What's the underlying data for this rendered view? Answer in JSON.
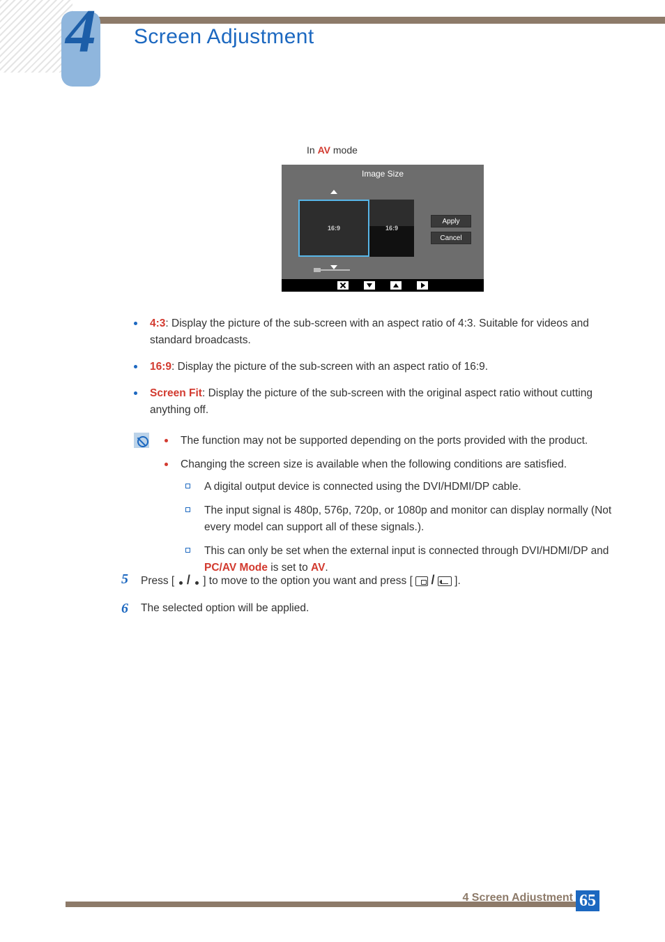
{
  "chapter": {
    "number": "4",
    "title": "Screen Adjustment"
  },
  "mode_label": {
    "prefix": "In ",
    "av": "AV",
    "suffix": " mode"
  },
  "osd": {
    "title": "Image Size",
    "left_ratio": "16:9",
    "right_ratio": "16:9",
    "apply": "Apply",
    "cancel": "Cancel"
  },
  "bullets": [
    {
      "term": "4:3",
      "text": ": Display the picture of the sub-screen with an aspect ratio of 4:3. Suitable for videos and standard broadcasts."
    },
    {
      "term": "16:9",
      "text": ": Display the picture of the sub-screen with an aspect ratio of 16:9."
    },
    {
      "term": "Screen Fit",
      "text": ": Display the picture of the sub-screen with the original aspect ratio without cutting anything off."
    }
  ],
  "notes": {
    "line1": "The function may not be supported depending on the ports provided with the product.",
    "line2": "Changing the screen size is available when the following conditions are satisfied.",
    "subs": [
      "A digital output device is connected using the DVI/HDMI/DP cable.",
      "The input signal is 480p, 576p, 720p, or 1080p and monitor can display normally (Not every model can support all of these signals.).",
      {
        "pre": "This can only be set when the external input is connected through DVI/HDMI/DP and ",
        "red1": "PC/AV Mode",
        "mid": " is set to ",
        "red2": "AV",
        "post": "."
      }
    ]
  },
  "steps": {
    "s5_pre": "Press [ ",
    "s5_mid": " ] to move to the option you want and press [",
    "s5_post": "].",
    "s6": "The selected option will be applied."
  },
  "footer": {
    "label": "4 Screen Adjustment",
    "page": "65"
  }
}
